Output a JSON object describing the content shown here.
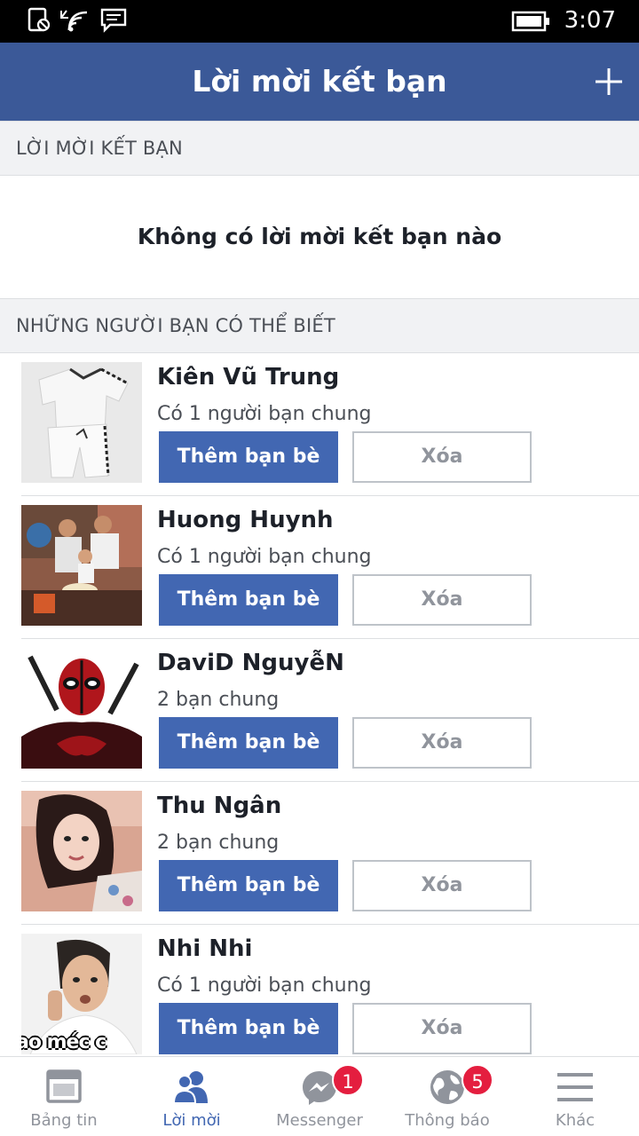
{
  "status_bar": {
    "time": "3:07",
    "icons": [
      "silent-mode-icon",
      "wifi-icon",
      "message-notification-icon",
      "battery-icon"
    ]
  },
  "header": {
    "title": "Lời mời kết bạn",
    "action_icon": "plus-icon"
  },
  "requests_section": {
    "heading": "LỜI MỜI KẾT BẠN",
    "empty_text": "Không có lời mời kết bạn nào"
  },
  "suggestions_section": {
    "heading": "NHỮNG NGƯỜI BẠN CÓ THỂ BIẾT",
    "people": [
      {
        "name": "Kiên Vũ Trung",
        "mutual": "Có 1 người bạn chung",
        "add_label": "Thêm bạn bè",
        "remove_label": "Xóa"
      },
      {
        "name": "Huong Huynh",
        "mutual": "Có 1 người bạn chung",
        "add_label": "Thêm bạn bè",
        "remove_label": "Xóa"
      },
      {
        "name": "DaviD NguyễN",
        "mutual": "2 bạn chung",
        "add_label": "Thêm bạn bè",
        "remove_label": "Xóa"
      },
      {
        "name": "Thu Ngân",
        "mutual": "2 bạn chung",
        "add_label": "Thêm bạn bè",
        "remove_label": "Xóa"
      },
      {
        "name": "Nhi Nhi",
        "mutual": "Có 1 người bạn chung",
        "add_label": "Thêm bạn bè",
        "remove_label": "Xóa",
        "avatar_caption": "ao méc c"
      }
    ]
  },
  "tab_bar": {
    "tabs": [
      {
        "label": "Bảng tin",
        "icon": "news-feed-icon"
      },
      {
        "label": "Lời mời",
        "icon": "friend-requests-icon",
        "active": true
      },
      {
        "label": "Messenger",
        "icon": "messenger-icon",
        "badge": "1"
      },
      {
        "label": "Thông báo",
        "icon": "globe-notifications-icon",
        "badge": "5"
      },
      {
        "label": "Khác",
        "icon": "menu-icon"
      }
    ]
  },
  "colors": {
    "brand_blue": "#3b5998",
    "button_blue": "#4267b2",
    "badge_red": "#e41e3f",
    "section_bg": "#f1f2f4"
  }
}
